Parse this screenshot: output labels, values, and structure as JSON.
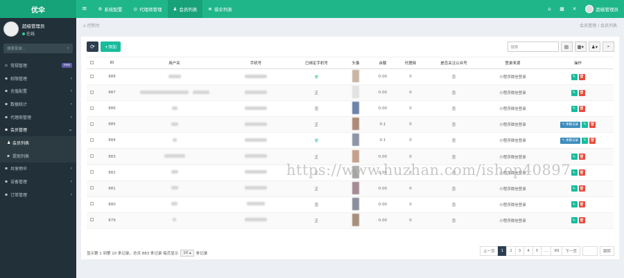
{
  "app": {
    "logo": "优伞"
  },
  "topnav": [
    {
      "icon": "≡",
      "label": ""
    },
    {
      "icon": "⚙",
      "label": "系统配置"
    },
    {
      "icon": "◎",
      "label": "代理商管理"
    },
    {
      "icon": "♟",
      "label": "会员列表"
    },
    {
      "icon": "≣",
      "label": "借伞列表"
    }
  ],
  "topright": {
    "user": "超级管理员"
  },
  "profile": {
    "name": "超级管理员",
    "status": "在线"
  },
  "sidebar": {
    "search_placeholder": "搜索菜单...",
    "items": [
      {
        "icon": "⌂",
        "label": "常规管理",
        "badge": "new",
        "arrow": ""
      },
      {
        "icon": "▪",
        "label": "权限管理",
        "badge": "",
        "arrow": "‹"
      },
      {
        "icon": "▪",
        "label": "充值配置",
        "badge": "",
        "arrow": "‹"
      },
      {
        "icon": "▪",
        "label": "数据统计",
        "badge": "",
        "arrow": "‹"
      },
      {
        "icon": "▪",
        "label": "代理商管理",
        "badge": "",
        "arrow": "‹"
      },
      {
        "icon": "▪",
        "label": "会员管理",
        "badge": "",
        "arrow": "⌄"
      },
      {
        "icon": "♟",
        "label": "会员列表",
        "badge": "",
        "arrow": ""
      },
      {
        "icon": "▪",
        "label": "提现列表",
        "badge": "",
        "arrow": ""
      },
      {
        "icon": "▪",
        "label": "共享雨伞",
        "badge": "",
        "arrow": "‹"
      },
      {
        "icon": "▪",
        "label": "设备管理",
        "badge": "",
        "arrow": "‹"
      },
      {
        "icon": "▪",
        "label": "订单管理",
        "badge": "",
        "arrow": "‹"
      }
    ]
  },
  "breadcrumb": {
    "left": "控制台",
    "right": "会员管理 / 会员列表"
  },
  "toolbar": {
    "add_label": "+添加",
    "search_placeholder": "搜索"
  },
  "table": {
    "headers": [
      "",
      "ID",
      "用户名",
      "手机号",
      "已绑定手机号",
      "头像",
      "余额",
      "代理商",
      "是否关注公众号",
      "登录来源",
      "操作"
    ],
    "rows": [
      {
        "id": "888",
        "bound": "是",
        "balance": "0.00",
        "agent": "0",
        "follow": "否",
        "source": "小程序微信登录",
        "rec": false,
        "thumb": "#c9b6a5"
      },
      {
        "id": "887",
        "bound": "正",
        "balance": "0.00",
        "agent": "0",
        "follow": "否",
        "source": "小程序微信登录",
        "rec": false,
        "thumb": "#e2e2e2"
      },
      {
        "id": "886",
        "bound": "否",
        "balance": "0.00",
        "agent": "0",
        "follow": "否",
        "source": "小程序微信登录",
        "rec": false,
        "thumb": "#6d83a8"
      },
      {
        "id": "885",
        "bound": "正",
        "balance": "0.1",
        "agent": "0",
        "follow": "否",
        "source": "小程序微信登录",
        "rec": true,
        "thumb": "#b08a78"
      },
      {
        "id": "884",
        "bound": "是",
        "balance": "0.1",
        "agent": "0",
        "follow": "否",
        "source": "小程序微信登录",
        "rec": true,
        "thumb": "#8c96a6"
      },
      {
        "id": "883",
        "bound": "正",
        "balance": "0.00",
        "agent": "0",
        "follow": "否",
        "source": "小程序微信登录",
        "rec": false,
        "thumb": "#c4a08c"
      },
      {
        "id": "882",
        "bound": "正",
        "balance": "0.00",
        "agent": "0",
        "follow": "否",
        "source": "小程序微信登录",
        "rec": false,
        "thumb": "#a7a5a3"
      },
      {
        "id": "881",
        "bound": "正",
        "balance": "0.00",
        "agent": "0",
        "follow": "否",
        "source": "小程序微信登录",
        "rec": false,
        "thumb": "#a58b95"
      },
      {
        "id": "880",
        "bound": "否",
        "balance": "0.00",
        "agent": "0",
        "follow": "否",
        "source": "小程序微信登录",
        "rec": false,
        "thumb": "#8b8f9b"
      },
      {
        "id": "879",
        "bound": "正",
        "balance": "0.00",
        "agent": "0",
        "follow": "否",
        "source": "小程序微信登录",
        "rec": false,
        "thumb": "#a88f7b"
      }
    ],
    "rec_label": "✎ 余额记录"
  },
  "footer": {
    "prefix": "显示第 1 到第 10 条记录，总共 883 条记录 每页显示",
    "per_page": "10 ▴",
    "suffix": "条记录"
  },
  "pager": {
    "prev": "上一页",
    "pages": [
      "1",
      "2",
      "3",
      "4",
      "5",
      "...",
      "89"
    ],
    "next": "下一页",
    "go": "跳转"
  },
  "watermark": "https://www.huzhan.com/ishop40897"
}
